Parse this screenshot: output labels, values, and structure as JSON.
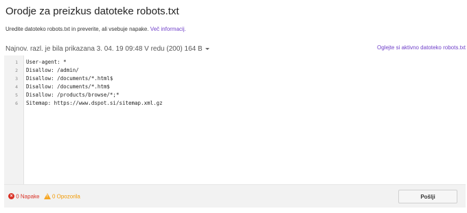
{
  "page": {
    "title": "Orodje za preizkus datoteke robots.txt",
    "description": "Uredite datoteko robots.txt in preverite, ali vsebuje napake.",
    "more_info_link": "Več informacij."
  },
  "version_bar": {
    "version_text": "Najnov. razl. je bila prikazana 3. 04. 19 09:48 V redu (200) 164 B",
    "live_link": "Oglejte si aktivno datoteko robots.txt"
  },
  "editor": {
    "line_numbers": [
      "1",
      "2",
      "3",
      "4",
      "5",
      "6"
    ],
    "lines": [
      "User-agent: *",
      "Disallow: /admin/",
      "Disallow: /documents/*.html$",
      "Disallow: /documents/*.htm$",
      "Disallow: /products/browse/*;*",
      "Sitemap: https://www.dspot.si/sitemap.xml.gz"
    ]
  },
  "status": {
    "errors": "0 Napake",
    "warnings": "0 Opozorila",
    "error_icon": "error-circle-icon",
    "warning_icon": "warning-triangle-icon"
  },
  "actions": {
    "submit_label": "Pošlji"
  },
  "colors": {
    "link": "#6f3fc9",
    "error": "#d93025",
    "warning": "#f29900"
  }
}
